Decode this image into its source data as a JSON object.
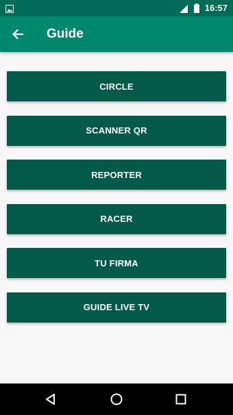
{
  "status_bar": {
    "time": "16:57",
    "icons": [
      "gallery-icon",
      "signal-icon",
      "battery-icon"
    ]
  },
  "app_bar": {
    "title": "Guide",
    "back_icon": "arrow-left-icon"
  },
  "menu": {
    "items": [
      {
        "label": "CIRCLE"
      },
      {
        "label": "SCANNER QR"
      },
      {
        "label": "REPORTER"
      },
      {
        "label": "RACER"
      },
      {
        "label": "TU FIRMA"
      },
      {
        "label": "GUIDE LIVE TV"
      }
    ]
  },
  "nav_bar": {
    "icons": [
      "back-triangle-icon",
      "home-circle-icon",
      "recents-square-icon"
    ]
  },
  "colors": {
    "status_bar": "#006b57",
    "app_bar": "#00886d",
    "button": "#045a48",
    "background": "#f7f7f7",
    "nav_bar": "#000000"
  }
}
